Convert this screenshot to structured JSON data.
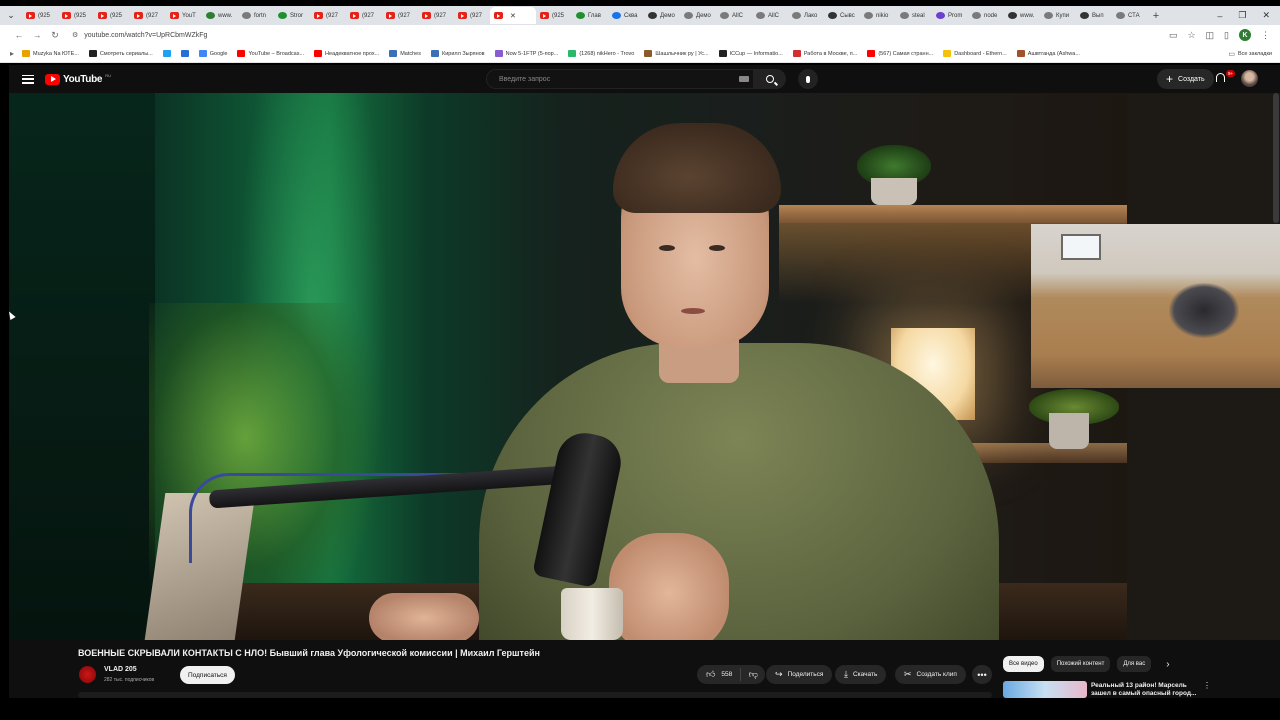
{
  "browser": {
    "tabs": [
      {
        "label": "(925",
        "fav": "yt"
      },
      {
        "label": "(925",
        "fav": "yt"
      },
      {
        "label": "(925",
        "fav": "yt"
      },
      {
        "label": "(927",
        "fav": "yt"
      },
      {
        "label": "YouT",
        "fav": "yt"
      },
      {
        "label": "www.",
        "fav": "green"
      },
      {
        "label": "fortn",
        "fav": "grey"
      },
      {
        "label": "Stror",
        "fav": "kick"
      },
      {
        "label": "(927",
        "fav": "yt"
      },
      {
        "label": "(927",
        "fav": "yt"
      },
      {
        "label": "(927",
        "fav": "yt"
      },
      {
        "label": "(927",
        "fav": "yt"
      },
      {
        "label": "(927",
        "fav": "yt"
      },
      {
        "label": "",
        "fav": "yt",
        "active": true
      },
      {
        "label": "(925",
        "fav": "yt"
      },
      {
        "label": "Глав",
        "fav": "kick"
      },
      {
        "label": "Сква",
        "fav": "blue"
      },
      {
        "label": "Демо",
        "fav": "dark"
      },
      {
        "label": "Демо",
        "fav": "grey"
      },
      {
        "label": "AllC",
        "fav": "grey"
      },
      {
        "label": "AllC",
        "fav": "grey"
      },
      {
        "label": "Лако",
        "fav": "grey"
      },
      {
        "label": "Сывс",
        "fav": "dark"
      },
      {
        "label": "nikio",
        "fav": "grey"
      },
      {
        "label": "steal",
        "fav": "grey"
      },
      {
        "label": "Prom",
        "fav": "purple"
      },
      {
        "label": "node",
        "fav": "grey"
      },
      {
        "label": "www.",
        "fav": "dark"
      },
      {
        "label": "Купи",
        "fav": "grey"
      },
      {
        "label": "Вып",
        "fav": "dark"
      },
      {
        "label": "СТА",
        "fav": "grey"
      }
    ],
    "new_tab_label": "+",
    "window_controls": [
      "–",
      "❐",
      "✕"
    ],
    "url": "youtube.com/watch?v=UpRCbmWZkFg",
    "bookmarks": [
      {
        "label": "Muzyka Na ЮТЕ...",
        "color": "#e8a200"
      },
      {
        "label": "Смотреть сериалы...",
        "color": "#222222"
      },
      {
        "label": "",
        "color": "#1da1f2"
      },
      {
        "label": "",
        "color": "#2a6fd6"
      },
      {
        "label": "Google",
        "color": "#4285f4"
      },
      {
        "label": "YouTube – Broadcas...",
        "color": "#ff0000"
      },
      {
        "label": "Неадекватное прох...",
        "color": "#ff0000"
      },
      {
        "label": "Matches",
        "color": "#3b6fb6"
      },
      {
        "label": "Кирилл Зырянов",
        "color": "#3b6fb6"
      },
      {
        "label": "Now 5-1FTP (5-пор...",
        "color": "#8a5cd1"
      },
      {
        "label": "(1268) nikHero - Trovo",
        "color": "#2ab86a"
      },
      {
        "label": "Шашлычник ру | Ус...",
        "color": "#8b5a2b"
      },
      {
        "label": "ICCup — Informatio...",
        "color": "#222222"
      },
      {
        "label": "Работа в Москве, п...",
        "color": "#d32f2f"
      },
      {
        "label": "(567) Самая странн...",
        "color": "#ff0000"
      },
      {
        "label": "Dashboard - Ethern...",
        "color": "#f4c20d"
      },
      {
        "label": "Ашвтганда (Ashwa...",
        "color": "#a0522d"
      }
    ],
    "all_bookmarks_label": "Все закладки"
  },
  "youtube": {
    "logo_text": "YouTube",
    "logo_region": "RU",
    "search_placeholder": "Введите запрос",
    "create_label": "Создать",
    "notifications_badge": "9+",
    "video": {
      "title": "ВОЕННЫЕ СКРЫВАЛИ КОНТАКТЫ С НЛО! Бывший глава Уфологической комиссии | Михаил Герштейн",
      "channel_name": "VLAD 205",
      "subscribers": "282 тыс. подписчиков",
      "subscribe_label": "Подписаться",
      "likes": "558",
      "share_label": "Поделиться",
      "download_label": "Скачать",
      "clip_label": "Создать клип",
      "more_label": "•••"
    },
    "chips": [
      {
        "label": "Все видео",
        "active": true
      },
      {
        "label": "Похожий контент",
        "active": false
      },
      {
        "label": "Для вас",
        "active": false
      }
    ],
    "recommendation": {
      "title": "Реальный 13 район! Марсель зашел в самый опасный город..."
    },
    "colors": {
      "brand": "#ff0000",
      "background": "#0f0f0f",
      "pill": "#272727"
    }
  }
}
